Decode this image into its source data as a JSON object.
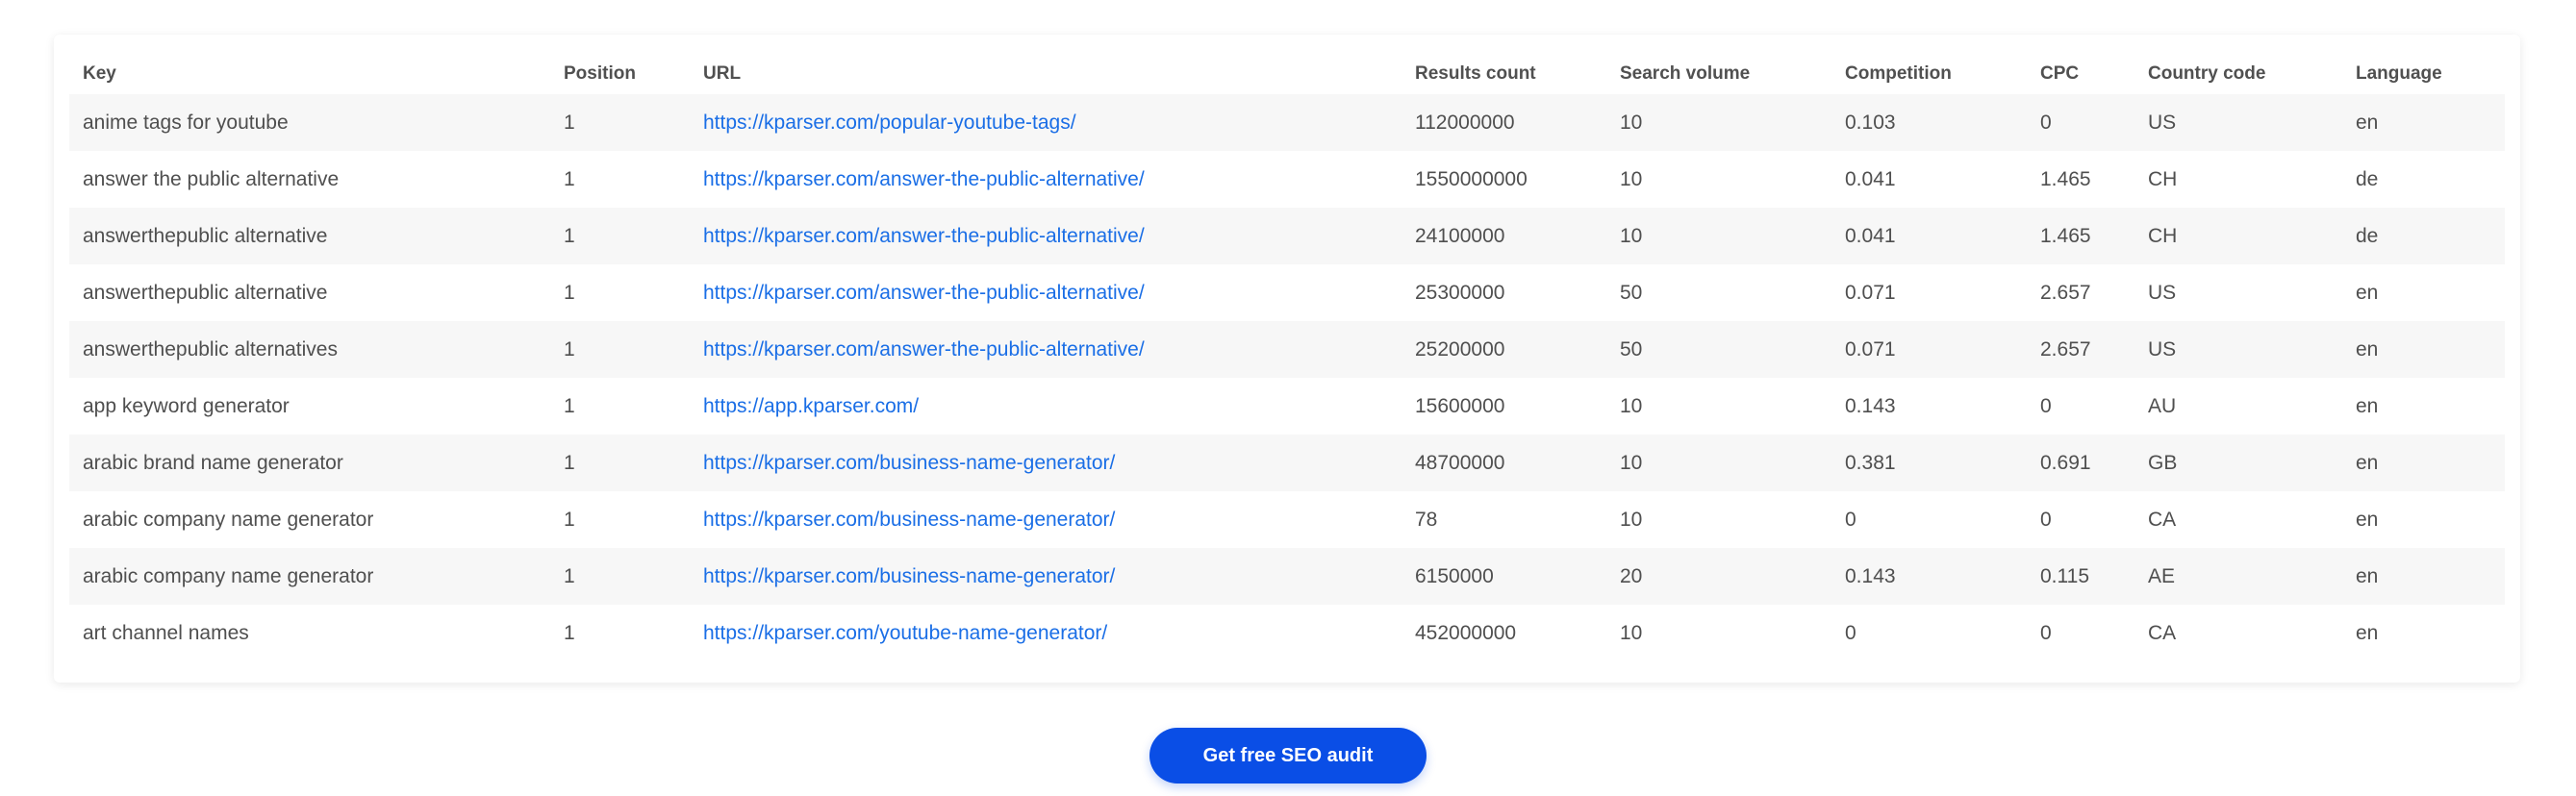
{
  "table": {
    "headers": [
      "Key",
      "Position",
      "URL",
      "Results count",
      "Search volume",
      "Competition",
      "CPC",
      "Country code",
      "Language"
    ],
    "rows": [
      {
        "key": "anime tags for youtube",
        "position": "1",
        "url": "https://kparser.com/popular-youtube-tags/",
        "results": "112000000",
        "volume": "10",
        "competition": "0.103",
        "cpc": "0",
        "country": "US",
        "language": "en"
      },
      {
        "key": "answer the public alternative",
        "position": "1",
        "url": "https://kparser.com/answer-the-public-alternative/",
        "results": "1550000000",
        "volume": "10",
        "competition": "0.041",
        "cpc": "1.465",
        "country": "CH",
        "language": "de"
      },
      {
        "key": "answerthepublic alternative",
        "position": "1",
        "url": "https://kparser.com/answer-the-public-alternative/",
        "results": "24100000",
        "volume": "10",
        "competition": "0.041",
        "cpc": "1.465",
        "country": "CH",
        "language": "de"
      },
      {
        "key": "answerthepublic alternative",
        "position": "1",
        "url": "https://kparser.com/answer-the-public-alternative/",
        "results": "25300000",
        "volume": "50",
        "competition": "0.071",
        "cpc": "2.657",
        "country": "US",
        "language": "en"
      },
      {
        "key": "answerthepublic alternatives",
        "position": "1",
        "url": "https://kparser.com/answer-the-public-alternative/",
        "results": "25200000",
        "volume": "50",
        "competition": "0.071",
        "cpc": "2.657",
        "country": "US",
        "language": "en"
      },
      {
        "key": "app keyword generator",
        "position": "1",
        "url": "https://app.kparser.com/",
        "results": "15600000",
        "volume": "10",
        "competition": "0.143",
        "cpc": "0",
        "country": "AU",
        "language": "en"
      },
      {
        "key": "arabic brand name generator",
        "position": "1",
        "url": "https://kparser.com/business-name-generator/",
        "results": "48700000",
        "volume": "10",
        "competition": "0.381",
        "cpc": "0.691",
        "country": "GB",
        "language": "en"
      },
      {
        "key": "arabic company name generator",
        "position": "1",
        "url": "https://kparser.com/business-name-generator/",
        "results": "78",
        "volume": "10",
        "competition": "0",
        "cpc": "0",
        "country": "CA",
        "language": "en"
      },
      {
        "key": "arabic company name generator",
        "position": "1",
        "url": "https://kparser.com/business-name-generator/",
        "results": "6150000",
        "volume": "20",
        "competition": "0.143",
        "cpc": "0.115",
        "country": "AE",
        "language": "en"
      },
      {
        "key": "art channel names",
        "position": "1",
        "url": "https://kparser.com/youtube-name-generator/",
        "results": "452000000",
        "volume": "10",
        "competition": "0",
        "cpc": "0",
        "country": "CA",
        "language": "en"
      }
    ]
  },
  "audit_button": {
    "label": "Get free SEO audit"
  },
  "colors": {
    "accent": "#0a4ee6",
    "link": "#1a6ee6",
    "stripe": "#f7f7f7"
  }
}
